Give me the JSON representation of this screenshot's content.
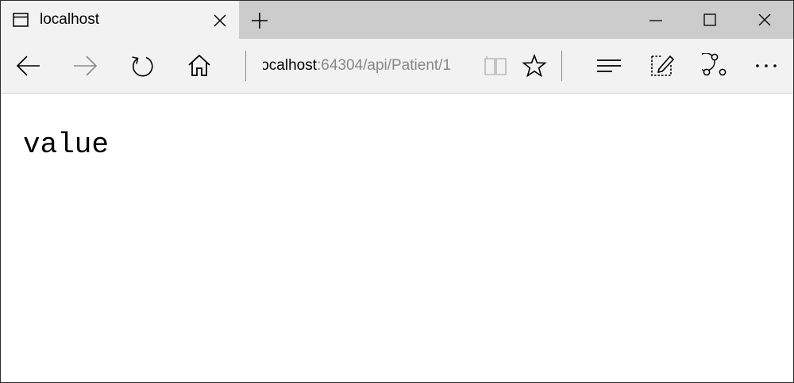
{
  "tab": {
    "title": "localhost",
    "page_icon": "page-icon",
    "close_icon": "close-icon"
  },
  "new_tab_icon": "plus-icon",
  "window_controls": [
    "minimize-icon",
    "maximize-icon",
    "close-icon"
  ],
  "toolbar": {
    "back_icon": "arrow-left-icon",
    "forward_icon": "arrow-right-icon",
    "refresh_icon": "refresh-icon",
    "home_icon": "home-icon",
    "reading_view_icon": "book-icon",
    "favorite_icon": "star-icon",
    "hub_icon": "hub-lines-icon",
    "web_note_icon": "pen-note-icon",
    "share_icon": "share-icon",
    "more_icon": "more-dots-icon"
  },
  "address": {
    "host": "localhost",
    "path": ":64304/api/Patient/1"
  },
  "page": {
    "body_text": "value"
  },
  "colors": {
    "titlebar": "#cccccc",
    "active_tab": "#f2f2f2",
    "toolbar": "#f2f2f2",
    "url_path": "#888888",
    "disabled_icon": "#8a8a8a"
  }
}
